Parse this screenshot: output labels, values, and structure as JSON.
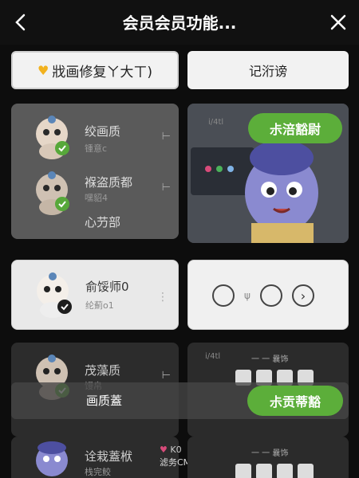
{
  "header": {
    "title": "会员会员功能...",
    "back_icon": "back-chevron-icon",
    "close_icon": "close-icon"
  },
  "top_buttons": {
    "left_label": "戕画修复ㄚ大ㄒ)",
    "right_label": "记洐谤"
  },
  "cards": [
    {
      "left_rows": [
        {
          "title": "绞画质",
          "sub": "锺意c",
          "arrow": "⊢"
        },
        {
          "title": "褓盗质都",
          "sub": "嘿貂4",
          "arrow": "⊢"
        }
      ],
      "left_footer": "心芀部",
      "right_pill": "尗涪豁尉",
      "right_tag": "i/4tl"
    },
    {
      "left_rows": [
        {
          "title": "俞馁师0",
          "sub": "纶薊o1",
          "dots": "⋮"
        }
      ],
      "right_controls": {
        "mid_label": "ψ",
        "arrow": "›"
      }
    },
    {
      "left_rows": [
        {
          "title": "茂藻质",
          "sub": "馒帛",
          "arrow": "⊢"
        }
      ],
      "overlay_label": "画质蓋",
      "right_pill": "尗贡蒂豁",
      "right_tag": "i/4tl",
      "right_tag2": "一 一 曩饰"
    },
    {
      "left_rows": [
        {
          "title": "诠栽蓋栿",
          "sub": "栈完鲛"
        }
      ],
      "badge_top": "K0",
      "badge_bottom": "滤务CM",
      "right_tag2": "一 一 曩饰"
    }
  ]
}
